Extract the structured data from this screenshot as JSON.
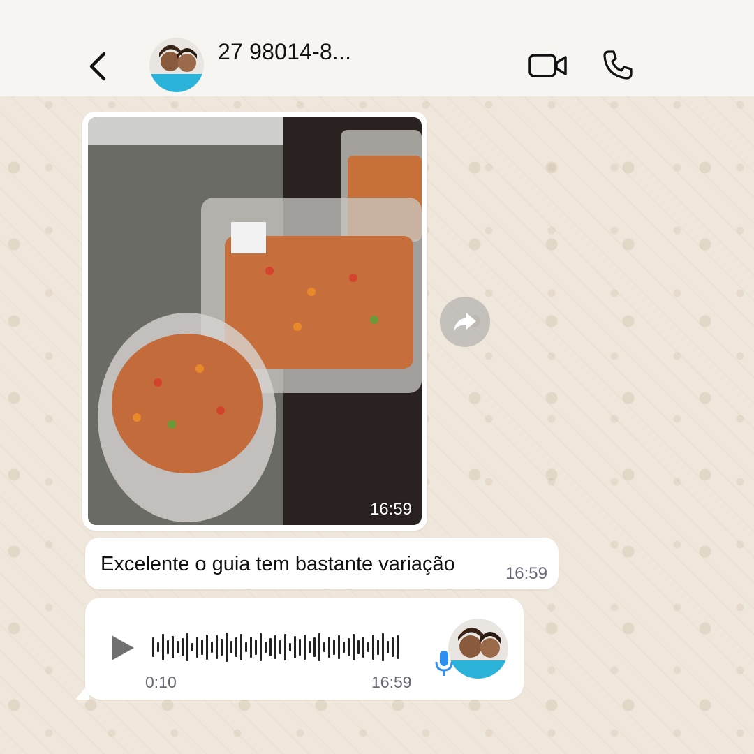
{
  "header": {
    "contact_name": "27 98014-8...",
    "back_icon": "chevron-left-icon",
    "video_icon": "video-camera-icon",
    "call_icon": "phone-icon"
  },
  "messages": {
    "image": {
      "time": "16:59"
    },
    "text": {
      "body": "Excelente o guia tem bastante variação",
      "time": "16:59"
    },
    "voice": {
      "duration": "0:10",
      "time": "16:59"
    }
  },
  "colors": {
    "header_bg": "#f6f5f1",
    "chat_bg": "#efe7db",
    "bubble_bg": "#ffffff",
    "mic_blue": "#2f8ff0"
  }
}
